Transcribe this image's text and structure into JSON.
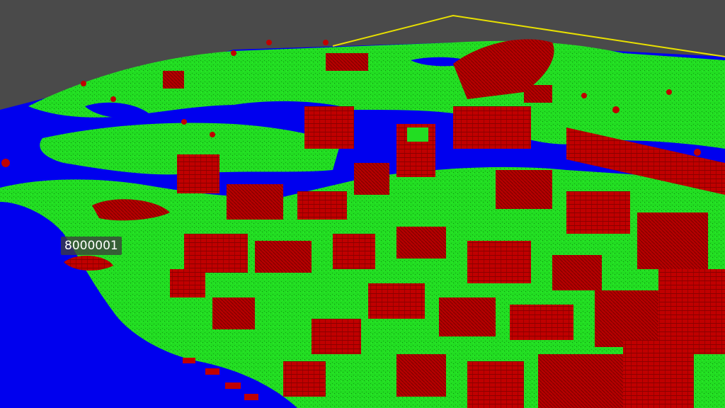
{
  "viewport": {
    "entity_label": "8000001"
  },
  "colors": {
    "background": "#4a4a4a",
    "water": "#0000ee",
    "terrain": "#22dd22",
    "buildings": "#c00000",
    "boundary_line": "#e8e000"
  },
  "icons": []
}
